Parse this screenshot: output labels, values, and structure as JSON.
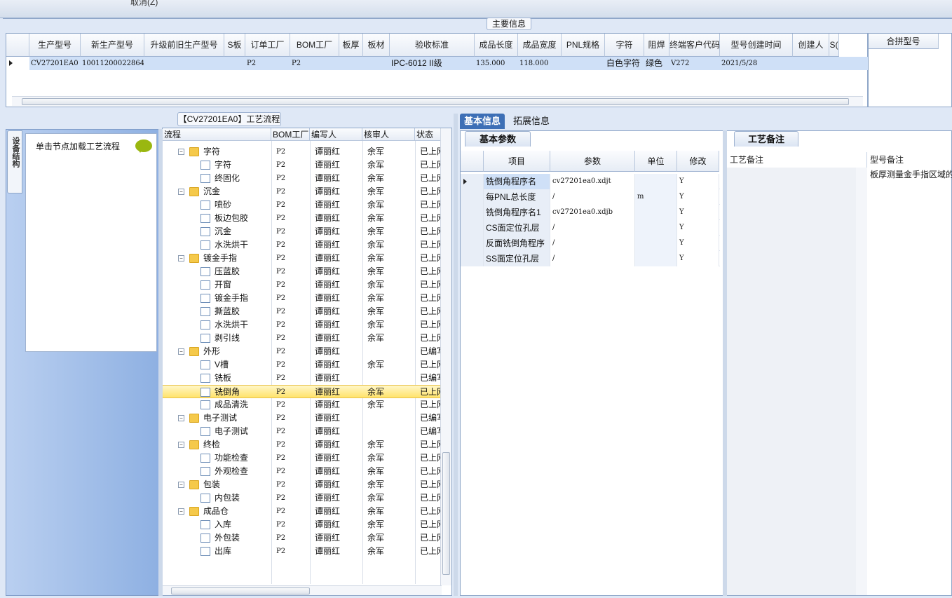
{
  "top": {
    "cancel_label": "取消(Z)"
  },
  "main_info": {
    "group_title": "主要信息",
    "columns": [
      "生产型号",
      "新生产型号",
      "升级前旧生产型号",
      "S板",
      "订单工厂",
      "BOM工厂",
      "板厚",
      "板材",
      "验收标准",
      "成品长度",
      "成品宽度",
      "PNL规格",
      "字符",
      "阻焊",
      "终端客户代码",
      "型号创建时间",
      "创建人",
      "S("
    ],
    "row": {
      "c0": "CV27201EA0",
      "c1": "10011200022864",
      "c2": "",
      "c3": "",
      "c4": "P2",
      "c5": "P2",
      "c6": "",
      "c7": "",
      "c8": "IPC-6012 II级",
      "c9": "135.000",
      "c10": "118.000",
      "c11": "",
      "c12": "白色字符",
      "c13": "绿色",
      "c14": "V272",
      "c15": "2021/5/28",
      "c16": "",
      "c17": ""
    },
    "merge_header": "合拼型号"
  },
  "left": {
    "vertical_tab": "设备结构",
    "hint": "单击节点加载工艺流程"
  },
  "flow": {
    "title": "【CV27201EA0】工艺流程",
    "columns": [
      "流程",
      "BOM工厂",
      "编写人",
      "核审人",
      "状态"
    ],
    "rows": [
      {
        "name": "字符",
        "folder": true,
        "bom": "P2",
        "writer": "谭丽红",
        "reviewer": "余军",
        "status": "已上网"
      },
      {
        "name": "字符",
        "folder": false,
        "bom": "P2",
        "writer": "谭丽红",
        "reviewer": "余军",
        "status": "已上网"
      },
      {
        "name": "终固化",
        "folder": false,
        "bom": "P2",
        "writer": "谭丽红",
        "reviewer": "余军",
        "status": "已上网"
      },
      {
        "name": "沉金",
        "folder": true,
        "bom": "P2",
        "writer": "谭丽红",
        "reviewer": "余军",
        "status": "已上网"
      },
      {
        "name": "喷砂",
        "folder": false,
        "bom": "P2",
        "writer": "谭丽红",
        "reviewer": "余军",
        "status": "已上网"
      },
      {
        "name": "板边包胶",
        "folder": false,
        "bom": "P2",
        "writer": "谭丽红",
        "reviewer": "余军",
        "status": "已上网"
      },
      {
        "name": "沉金",
        "folder": false,
        "bom": "P2",
        "writer": "谭丽红",
        "reviewer": "余军",
        "status": "已上网"
      },
      {
        "name": "水洗烘干",
        "folder": false,
        "bom": "P2",
        "writer": "谭丽红",
        "reviewer": "余军",
        "status": "已上网"
      },
      {
        "name": "镀金手指",
        "folder": true,
        "bom": "P2",
        "writer": "谭丽红",
        "reviewer": "余军",
        "status": "已上网"
      },
      {
        "name": "压蓝胶",
        "folder": false,
        "bom": "P2",
        "writer": "谭丽红",
        "reviewer": "余军",
        "status": "已上网"
      },
      {
        "name": "开窗",
        "folder": false,
        "bom": "P2",
        "writer": "谭丽红",
        "reviewer": "余军",
        "status": "已上网"
      },
      {
        "name": "镀金手指",
        "folder": false,
        "bom": "P2",
        "writer": "谭丽红",
        "reviewer": "余军",
        "status": "已上网"
      },
      {
        "name": "撕蓝胶",
        "folder": false,
        "bom": "P2",
        "writer": "谭丽红",
        "reviewer": "余军",
        "status": "已上网"
      },
      {
        "name": "水洗烘干",
        "folder": false,
        "bom": "P2",
        "writer": "谭丽红",
        "reviewer": "余军",
        "status": "已上网"
      },
      {
        "name": "剥引线",
        "folder": false,
        "bom": "P2",
        "writer": "谭丽红",
        "reviewer": "余军",
        "status": "已上网"
      },
      {
        "name": "外形",
        "folder": true,
        "bom": "P2",
        "writer": "谭丽红",
        "reviewer": "",
        "status": "已编写"
      },
      {
        "name": "V槽",
        "folder": false,
        "bom": "P2",
        "writer": "谭丽红",
        "reviewer": "余军",
        "status": "已上网"
      },
      {
        "name": "铣板",
        "folder": false,
        "bom": "P2",
        "writer": "谭丽红",
        "reviewer": "",
        "status": "已编写"
      },
      {
        "name": "铣倒角",
        "folder": false,
        "bom": "P2",
        "writer": "谭丽红",
        "reviewer": "余军",
        "status": "已上网",
        "selected": true
      },
      {
        "name": "成品清洗",
        "folder": false,
        "bom": "P2",
        "writer": "谭丽红",
        "reviewer": "余军",
        "status": "已上网"
      },
      {
        "name": "电子测试",
        "folder": true,
        "bom": "P2",
        "writer": "谭丽红",
        "reviewer": "",
        "status": "已编写"
      },
      {
        "name": "电子测试",
        "folder": false,
        "bom": "P2",
        "writer": "谭丽红",
        "reviewer": "",
        "status": "已编写"
      },
      {
        "name": "终检",
        "folder": true,
        "bom": "P2",
        "writer": "谭丽红",
        "reviewer": "余军",
        "status": "已上网"
      },
      {
        "name": "功能检查",
        "folder": false,
        "bom": "P2",
        "writer": "谭丽红",
        "reviewer": "余军",
        "status": "已上网"
      },
      {
        "name": "外观检查",
        "folder": false,
        "bom": "P2",
        "writer": "谭丽红",
        "reviewer": "余军",
        "status": "已上网"
      },
      {
        "name": "包装",
        "folder": true,
        "bom": "P2",
        "writer": "谭丽红",
        "reviewer": "余军",
        "status": "已上网"
      },
      {
        "name": "内包装",
        "folder": false,
        "bom": "P2",
        "writer": "谭丽红",
        "reviewer": "余军",
        "status": "已上网"
      },
      {
        "name": "成品仓",
        "folder": true,
        "bom": "P2",
        "writer": "谭丽红",
        "reviewer": "余军",
        "status": "已上网"
      },
      {
        "name": "入库",
        "folder": false,
        "bom": "P2",
        "writer": "谭丽红",
        "reviewer": "余军",
        "status": "已上网"
      },
      {
        "name": "外包装",
        "folder": false,
        "bom": "P2",
        "writer": "谭丽红",
        "reviewer": "余军",
        "status": "已上网"
      },
      {
        "name": "出库",
        "folder": false,
        "bom": "P2",
        "writer": "谭丽红",
        "reviewer": "余军",
        "status": "已上网"
      }
    ]
  },
  "tabs": {
    "basic": "基本信息",
    "extended": "拓展信息"
  },
  "basic_params": {
    "title": "基本参数",
    "columns": [
      "项目",
      "参数",
      "单位",
      "修改"
    ],
    "rows": [
      {
        "item": "铣倒角程序名",
        "param": "cv27201ea0.xdjt",
        "unit": "",
        "edit": "Y"
      },
      {
        "item": "每PNL总长度",
        "param": "/",
        "unit": "m",
        "edit": "Y"
      },
      {
        "item": "铣倒角程序名1",
        "param": "cv27201ea0.xdjb",
        "unit": "",
        "edit": "Y"
      },
      {
        "item": "CS面定位孔层",
        "param": "/",
        "unit": "",
        "edit": "Y"
      },
      {
        "item": "反面铣倒角程序",
        "param": "/",
        "unit": "",
        "edit": "Y"
      },
      {
        "item": "SS面定位孔层",
        "param": "/",
        "unit": "",
        "edit": "Y"
      }
    ]
  },
  "remarks": {
    "title": "工艺备注",
    "col_process": "工艺备注",
    "col_model": "型号备注",
    "model_text": "板厚测量金手指区域的"
  }
}
